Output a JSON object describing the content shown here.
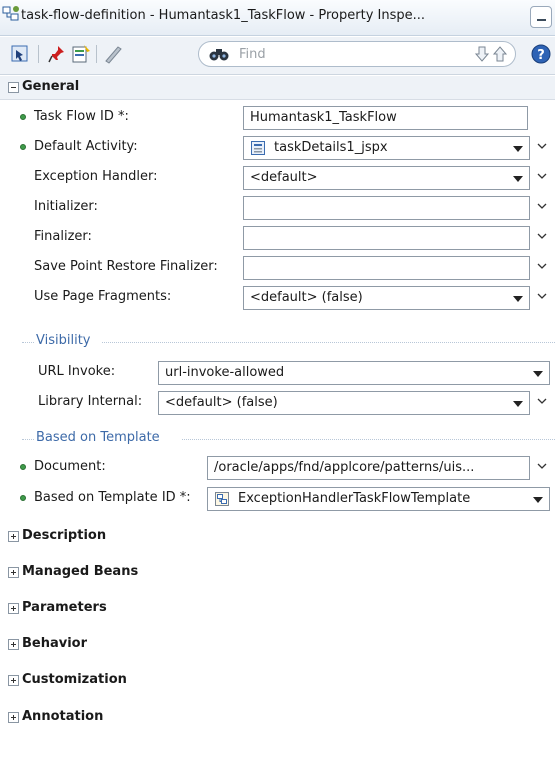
{
  "window": {
    "title": "task-flow-definition - Humantask1_TaskFlow - Property Inspe..."
  },
  "toolbar": {
    "search_placeholder": "Find"
  },
  "general": {
    "label": "General",
    "fields": [
      {
        "label": "Task Flow ID *:",
        "value": "Humantask1_TaskFlow",
        "required": true,
        "kind": "text"
      },
      {
        "label": "Default Activity:",
        "value": "taskDetails1_jspx",
        "required": true,
        "kind": "select",
        "icon": "page-icon"
      },
      {
        "label": "Exception Handler:",
        "value": "<default>",
        "required": false,
        "kind": "select"
      },
      {
        "label": "Initializer:",
        "value": "",
        "required": false,
        "kind": "text"
      },
      {
        "label": "Finalizer:",
        "value": "",
        "required": false,
        "kind": "text"
      },
      {
        "label": "Save Point Restore Finalizer:",
        "value": "",
        "required": false,
        "kind": "text"
      },
      {
        "label": "Use Page Fragments:",
        "value": "<default> (false)",
        "required": false,
        "kind": "select"
      }
    ],
    "visibility": {
      "label": "Visibility",
      "fields": [
        {
          "label": "URL Invoke:",
          "value": "url-invoke-allowed",
          "kind": "select"
        },
        {
          "label": "Library Internal:",
          "value": "<default> (false)",
          "kind": "select"
        }
      ]
    },
    "based_on_template": {
      "label": "Based on Template",
      "fields": [
        {
          "label": "Document:",
          "value": "/oracle/apps/fnd/applcore/patterns/uis...",
          "required": true,
          "kind": "text"
        },
        {
          "label": "Based on Template ID *:",
          "value": "ExceptionHandlerTaskFlowTemplate",
          "required": true,
          "kind": "select",
          "icon": "template-icon"
        }
      ]
    }
  },
  "collapsed_sections": [
    "Description",
    "Managed Beans",
    "Parameters",
    "Behavior",
    "Customization",
    "Annotation"
  ],
  "colors": {
    "accent": "#3d6aa8",
    "required_dot": "#3e9b4a",
    "header_bg": "#eef2f7"
  }
}
